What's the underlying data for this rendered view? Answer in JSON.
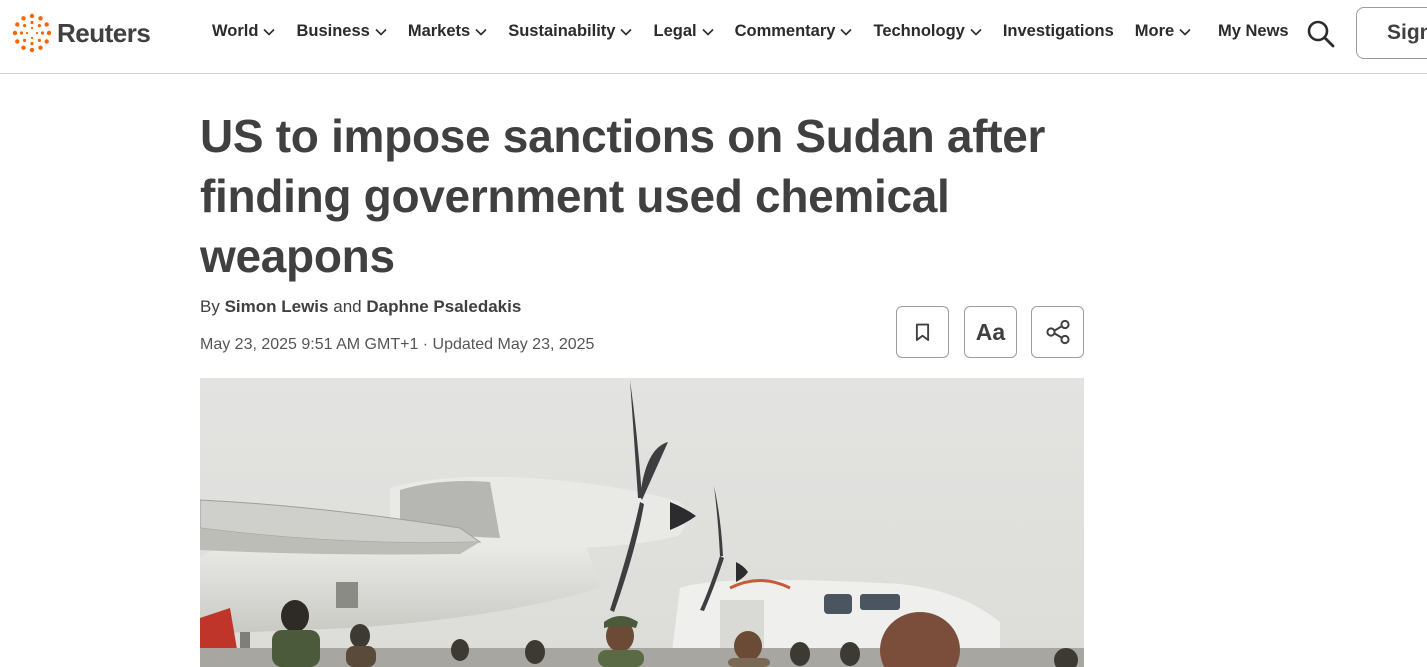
{
  "brand": {
    "name": "Reuters",
    "accent": "#fa6400"
  },
  "nav": {
    "items": [
      {
        "label": "World",
        "dropdown": true
      },
      {
        "label": "Business",
        "dropdown": true
      },
      {
        "label": "Markets",
        "dropdown": true
      },
      {
        "label": "Sustainability",
        "dropdown": true
      },
      {
        "label": "Legal",
        "dropdown": true
      },
      {
        "label": "Commentary",
        "dropdown": true
      },
      {
        "label": "Technology",
        "dropdown": true
      },
      {
        "label": "Investigations",
        "dropdown": false
      },
      {
        "label": "More",
        "dropdown": true
      }
    ],
    "my_news": "My News",
    "search_icon": "search-icon",
    "signin_label": "Sign"
  },
  "article": {
    "headline": "US to impose sanctions on Sudan after finding government used chemical weapons",
    "byline_prefix": "By",
    "authors": [
      "Simon Lewis",
      "Daphne Psaledakis"
    ],
    "byline_joiner": "and",
    "dateline": "May 23, 2025 9:51 AM GMT+1 · Updated May 23, 2025",
    "tools": {
      "bookmark_icon": "bookmark-icon",
      "text_size_label": "Aa",
      "share_icon": "share-icon"
    }
  },
  "hero_image": {
    "description_icon": "photo-aircraft-officials"
  }
}
